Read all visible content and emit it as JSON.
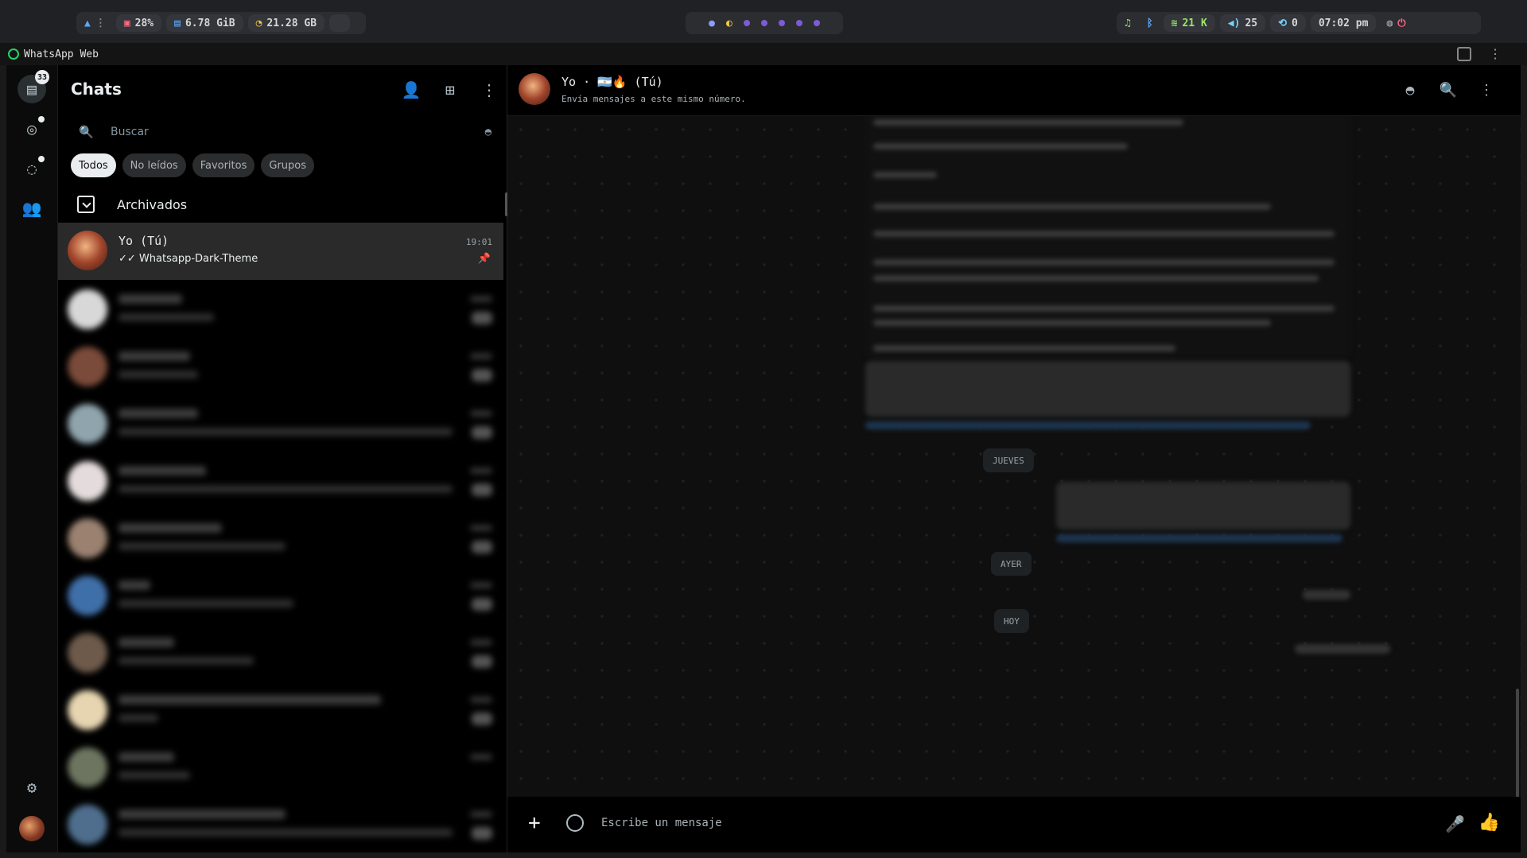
{
  "sysbar": {
    "cpu": "28%",
    "ram": "6.78 GiB",
    "disk": "21.28 GB",
    "wifi": "21 K",
    "volume": "25",
    "updates": "0",
    "clock": "07:02 pm"
  },
  "browser": {
    "title": "WhatsApp Web"
  },
  "rail": {
    "chats_badge": "33"
  },
  "list": {
    "title": "Chats",
    "search_placeholder": "Buscar",
    "filters": [
      "Todos",
      "No leídos",
      "Favoritos",
      "Grupos"
    ],
    "archived_label": "Archivados",
    "pinned_chat": {
      "name": "Yo (Tú)",
      "last": "✓✓ Whatsapp-Dark-Theme",
      "time": "19:01"
    }
  },
  "convo": {
    "name": "Yo · 🇦🇷🔥 (Tú)",
    "subtitle": "Envía mensajes a este mismo número.",
    "dates": [
      "JUEVES",
      "AYER",
      "HOY"
    ],
    "composer_placeholder": "Escribe un mensaje"
  },
  "icons": {
    "rail": [
      "chats-icon",
      "status-icon",
      "channels-icon",
      "communities-icon",
      "settings-icon"
    ],
    "header": [
      "new-chat-icon",
      "new-group-icon",
      "menu-icon"
    ],
    "convo_header": [
      "incognito-icon",
      "search-icon",
      "menu-icon"
    ]
  },
  "colors": {
    "accent": "#25d366",
    "background": "#000000",
    "pinned_row": "#2a2a2a"
  }
}
